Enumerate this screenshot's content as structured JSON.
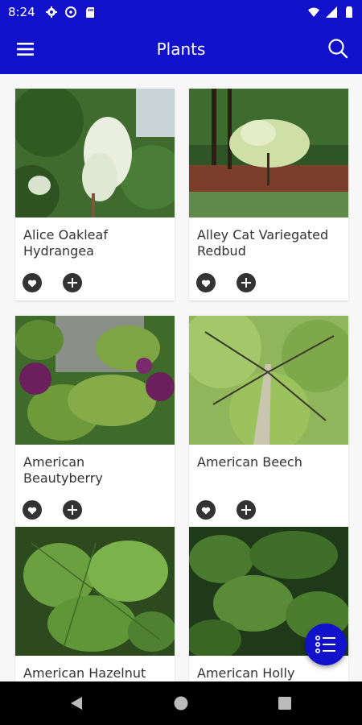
{
  "status_bar": {
    "time": "8:24"
  },
  "app_bar": {
    "title": "Plants",
    "menu_icon": "hamburger-menu-icon",
    "search_icon": "search-icon"
  },
  "plants": [
    {
      "name": "Alice Oakleaf Hydrangea"
    },
    {
      "name": "Alley Cat Variegated Redbud"
    },
    {
      "name": "American Beautyberry"
    },
    {
      "name": "American Beech"
    },
    {
      "name": "American Hazelnut"
    },
    {
      "name": "American Holly"
    }
  ],
  "fab": {
    "icon": "list-icon"
  },
  "colors": {
    "primary": "#1111cc",
    "icon_dark": "#333333",
    "card_bg": "#ffffff",
    "page_bg": "#f7f7f7"
  }
}
